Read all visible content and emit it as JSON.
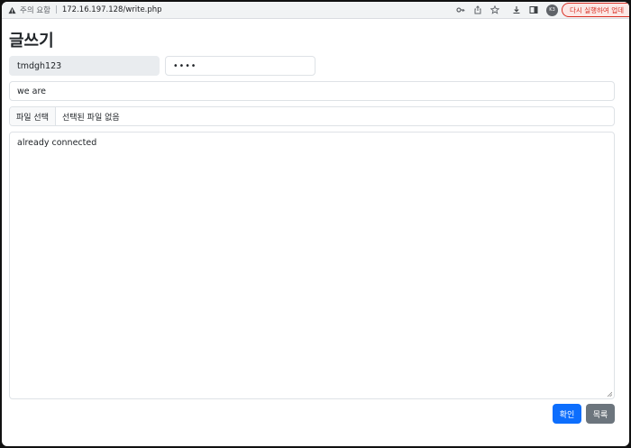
{
  "browser": {
    "security_label": "주의 요함",
    "url": "172.16.197.128/write.php",
    "profile_initials": "K3",
    "restart_label": "다시 실행하여 업데"
  },
  "page": {
    "title": "글쓰기"
  },
  "form": {
    "author_value": "tmdgh123",
    "password_value": "••••",
    "subject_value": "we are",
    "file_button_label": "파일 선택",
    "file_status": "선택된 파일 없음",
    "content_value": "already connected",
    "submit_label": "확인",
    "list_label": "목록"
  },
  "colors": {
    "primary": "#0d6efd",
    "secondary": "#6c757d",
    "restart_accent": "#d93025"
  }
}
